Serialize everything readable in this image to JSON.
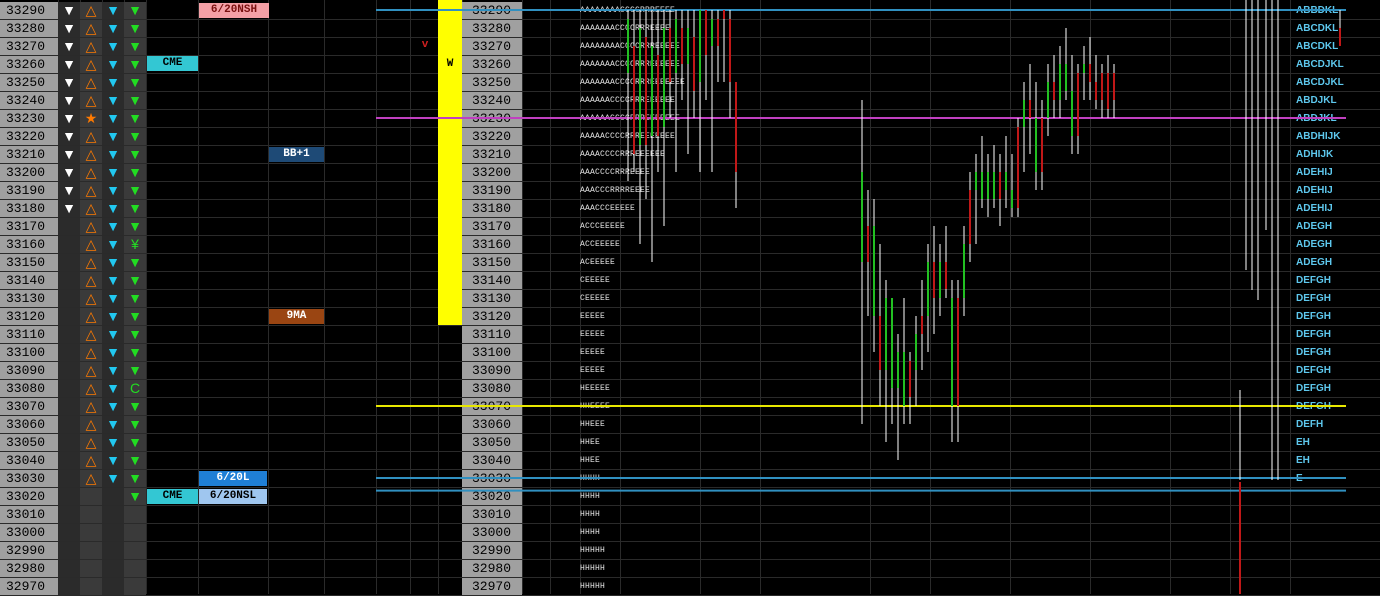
{
  "prices": [
    "33290",
    "33280",
    "33270",
    "33260",
    "33250",
    "33240",
    "33230",
    "33220",
    "33210",
    "33200",
    "33190",
    "33180",
    "33170",
    "33160",
    "33150",
    "33140",
    "33130",
    "33120",
    "33110",
    "33100",
    "33090",
    "33080",
    "33070",
    "33060",
    "33050",
    "33040",
    "33030",
    "33020",
    "33010",
    "33000",
    "32990",
    "32980",
    "32970"
  ],
  "tags": {
    "nsh": "6/20NSH",
    "cme_top": "CME",
    "bb": "BB+1",
    "ma": "9MA",
    "l620": "6/20L",
    "cme_bottom": "CME",
    "nsl": "6/20NSL",
    "v_mark": "v",
    "w_mark": "W"
  },
  "symbols": {
    "star": "★",
    "yen": "¥",
    "c": "C"
  },
  "tpo_left": [
    "AAAAAAAACCCCRRREEEE",
    "AAAAAAACCCCRRREEEE",
    "AAAAAAAACCCCRRREEEEE",
    "AAAAAAACCCCRRREEEEEE",
    "AAAAAAACCCCRRREEEEEEE",
    "AAAAAACCCCRRREEEEEE",
    "AAAAAACCCCRRREEEEEEE",
    "AAAAACCCCRRREEEEEEE",
    "AAAACCCCRRREEEEEE",
    "AAACCCCRRREEEE",
    "AAACCCRRRREEEE",
    "AAACCCEEEEE",
    "ACCCEEEEE",
    "ACCEEEEE",
    "ACEEEEE",
    "CEEEEE",
    "CEEEEE",
    "EEEEE",
    "EEEEE",
    "EEEEE",
    "EEEEE",
    "HEEEEE",
    "HHEEEE",
    "HHEEE",
    "HHEE",
    "HHEE",
    "HHHH",
    "HHHH",
    "HHHH",
    "HHHH",
    "HHHHH",
    "HHHHH",
    "HHHHH"
  ],
  "tpo_right": [
    "ABBDKL",
    "ABCDKL",
    "ABCDKL",
    "ABCDJKL",
    "ABCDJKL",
    "ABDJKL",
    "ABDJKL",
    "ABDHIJK",
    "ADHIJK",
    "ADEHIJ",
    "ADEHIJ",
    "ADEHIJ",
    "ADEGH",
    "ADEGH",
    "ADEGH",
    "DEFGH",
    "DEFGH",
    "DEFGH",
    "DEFGH",
    "DEFGH",
    "DEFGH",
    "DEFGH",
    "DEFGH",
    "DEFH",
    "EH",
    "EH",
    "E",
    "",
    "",
    "",
    "",
    "",
    ""
  ],
  "colors": {
    "price_bg": "#a0a0a0",
    "up": "#22c022",
    "down": "#c01818",
    "cyan_tag": "#33c7d3",
    "pink_tag": "#f4a0a6",
    "blue_tag": "#1f7fd6",
    "brown_tag": "#9a4512",
    "navy_tag": "#1e4a76",
    "yellow_bar": "#ffff00",
    "magenta_line": "#c040c0",
    "yellow_line": "#e8e800",
    "blue_line": "#3090c0"
  },
  "chart_data": {
    "type": "candlestick",
    "ylim": [
      32970,
      33290
    ],
    "candles": [
      {
        "o": 33255,
        "h": 33290,
        "l": 33195,
        "c": 33285,
        "up": true
      },
      {
        "o": 33270,
        "h": 33290,
        "l": 33200,
        "c": 33210,
        "up": false
      },
      {
        "o": 33215,
        "h": 33290,
        "l": 33160,
        "c": 33280,
        "up": true
      },
      {
        "o": 33275,
        "h": 33290,
        "l": 33185,
        "c": 33215,
        "up": false
      },
      {
        "o": 33220,
        "h": 33290,
        "l": 33150,
        "c": 33270,
        "up": true
      },
      {
        "o": 33265,
        "h": 33290,
        "l": 33200,
        "c": 33220,
        "up": false
      },
      {
        "o": 33225,
        "h": 33290,
        "l": 33170,
        "c": 33280,
        "up": true
      },
      {
        "o": 33280,
        "h": 33290,
        "l": 33230,
        "c": 33250,
        "up": false
      },
      {
        "o": 33255,
        "h": 33290,
        "l": 33200,
        "c": 33285,
        "up": true
      },
      {
        "o": 33280,
        "h": 33290,
        "l": 33240,
        "c": 33260,
        "up": false
      },
      {
        "o": 33260,
        "h": 33290,
        "l": 33210,
        "c": 33280,
        "up": true
      },
      {
        "o": 33275,
        "h": 33290,
        "l": 33230,
        "c": 33245,
        "up": false
      },
      {
        "o": 33250,
        "h": 33290,
        "l": 33200,
        "c": 33290,
        "up": true
      },
      {
        "o": 33290,
        "h": 33290,
        "l": 33240,
        "c": 33265,
        "up": false
      },
      {
        "o": 33270,
        "h": 33290,
        "l": 33200,
        "c": 33285,
        "up": true
      },
      {
        "o": 33285,
        "h": 33290,
        "l": 33250,
        "c": 33270,
        "up": false
      },
      {
        "o": 33290,
        "h": 33290,
        "l": 33250,
        "c": 33285,
        "up": false
      },
      {
        "o": 33285,
        "h": 33290,
        "l": 33230,
        "c": 33250,
        "up": false
      },
      {
        "o": 33250,
        "h": 33250,
        "l": 33180,
        "c": 33200,
        "up": false
      },
      {
        "o": 33200,
        "h": 33240,
        "l": 33060,
        "c": 33150,
        "up": true
      },
      {
        "o": 33150,
        "h": 33190,
        "l": 33120,
        "c": 33170,
        "up": false
      },
      {
        "o": 33170,
        "h": 33185,
        "l": 33100,
        "c": 33120,
        "up": true
      },
      {
        "o": 33120,
        "h": 33160,
        "l": 33070,
        "c": 33090,
        "up": false
      },
      {
        "o": 33090,
        "h": 33140,
        "l": 33050,
        "c": 33130,
        "up": true
      },
      {
        "o": 33130,
        "h": 33130,
        "l": 33060,
        "c": 33080,
        "up": true
      },
      {
        "o": 33080,
        "h": 33110,
        "l": 33040,
        "c": 33100,
        "up": true
      },
      {
        "o": 33100,
        "h": 33130,
        "l": 33060,
        "c": 33070,
        "up": true
      },
      {
        "o": 33075,
        "h": 33100,
        "l": 33060,
        "c": 33095,
        "up": false
      },
      {
        "o": 33090,
        "h": 33120,
        "l": 33070,
        "c": 33110,
        "up": true
      },
      {
        "o": 33110,
        "h": 33140,
        "l": 33090,
        "c": 33120,
        "up": false
      },
      {
        "o": 33120,
        "h": 33160,
        "l": 33100,
        "c": 33150,
        "up": true
      },
      {
        "o": 33150,
        "h": 33170,
        "l": 33110,
        "c": 33130,
        "up": false
      },
      {
        "o": 33130,
        "h": 33160,
        "l": 33120,
        "c": 33150,
        "up": true
      },
      {
        "o": 33150,
        "h": 33170,
        "l": 33130,
        "c": 33135,
        "up": false
      },
      {
        "o": 33130,
        "h": 33140,
        "l": 33050,
        "c": 33070,
        "up": true
      },
      {
        "o": 33070,
        "h": 33140,
        "l": 33050,
        "c": 33130,
        "up": false
      },
      {
        "o": 33130,
        "h": 33170,
        "l": 33120,
        "c": 33160,
        "up": true
      },
      {
        "o": 33160,
        "h": 33200,
        "l": 33150,
        "c": 33190,
        "up": false
      },
      {
        "o": 33190,
        "h": 33210,
        "l": 33160,
        "c": 33200,
        "up": true
      },
      {
        "o": 33200,
        "h": 33220,
        "l": 33180,
        "c": 33185,
        "up": true
      },
      {
        "o": 33185,
        "h": 33210,
        "l": 33175,
        "c": 33200,
        "up": true
      },
      {
        "o": 33200,
        "h": 33215,
        "l": 33180,
        "c": 33185,
        "up": true
      },
      {
        "o": 33185,
        "h": 33210,
        "l": 33170,
        "c": 33200,
        "up": false
      },
      {
        "o": 33200,
        "h": 33220,
        "l": 33180,
        "c": 33190,
        "up": true
      },
      {
        "o": 33190,
        "h": 33210,
        "l": 33175,
        "c": 33180,
        "up": true
      },
      {
        "o": 33180,
        "h": 33230,
        "l": 33175,
        "c": 33225,
        "up": false
      },
      {
        "o": 33225,
        "h": 33250,
        "l": 33200,
        "c": 33240,
        "up": true
      },
      {
        "o": 33240,
        "h": 33260,
        "l": 33210,
        "c": 33230,
        "up": false
      },
      {
        "o": 33230,
        "h": 33250,
        "l": 33190,
        "c": 33200,
        "up": true
      },
      {
        "o": 33200,
        "h": 33240,
        "l": 33190,
        "c": 33230,
        "up": false
      },
      {
        "o": 33230,
        "h": 33260,
        "l": 33220,
        "c": 33250,
        "up": true
      },
      {
        "o": 33250,
        "h": 33265,
        "l": 33230,
        "c": 33240,
        "up": false
      },
      {
        "o": 33240,
        "h": 33270,
        "l": 33230,
        "c": 33260,
        "up": true
      },
      {
        "o": 33260,
        "h": 33280,
        "l": 33240,
        "c": 33245,
        "up": true
      },
      {
        "o": 33245,
        "h": 33265,
        "l": 33210,
        "c": 33220,
        "up": true
      },
      {
        "o": 33220,
        "h": 33260,
        "l": 33210,
        "c": 33255,
        "up": false
      },
      {
        "o": 33255,
        "h": 33270,
        "l": 33240,
        "c": 33260,
        "up": true
      },
      {
        "o": 33260,
        "h": 33275,
        "l": 33240,
        "c": 33250,
        "up": false
      },
      {
        "o": 33250,
        "h": 33265,
        "l": 33235,
        "c": 33240,
        "up": false
      },
      {
        "o": 33240,
        "h": 33260,
        "l": 33230,
        "c": 33255,
        "up": false
      },
      {
        "o": 33255,
        "h": 33265,
        "l": 33230,
        "c": 33235,
        "up": false
      },
      {
        "o": 33240,
        "h": 33260,
        "l": 33230,
        "c": 33255,
        "up": false
      },
      {
        "o": 33270,
        "h": 33290,
        "l": 33270,
        "c": 33280,
        "up": false
      }
    ],
    "lines": [
      {
        "price": 33290,
        "color": "#3090c0"
      },
      {
        "price": 33230,
        "color": "#c040c0"
      },
      {
        "price": 33070,
        "color": "#e8e800"
      },
      {
        "price": 33030,
        "color": "#3090c0"
      },
      {
        "price": 33023,
        "color": "#3090c0"
      }
    ]
  }
}
